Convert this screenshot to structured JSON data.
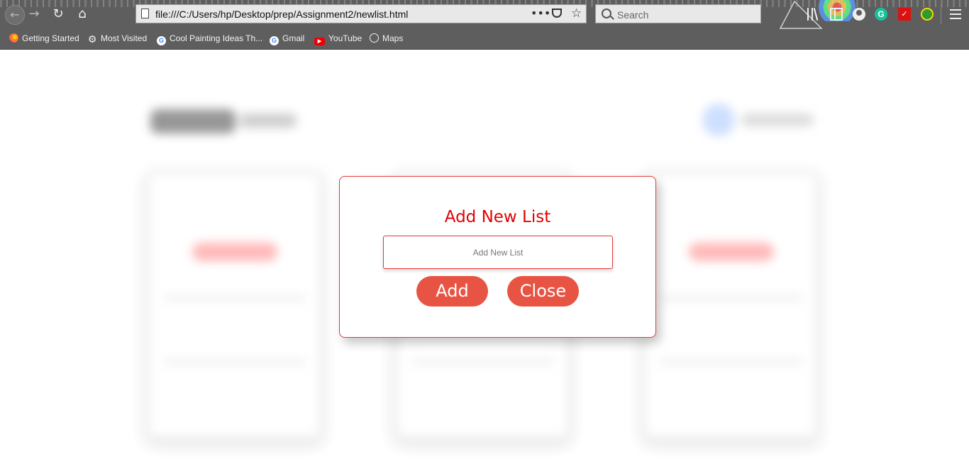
{
  "browser": {
    "url": "file:///C:/Users/hp/Desktop/prep/Assignment2/newlist.html",
    "search_placeholder": "Search",
    "more_glyph": "•••",
    "bookmarks": [
      {
        "label": "Getting Started",
        "icon": "firefox-icon"
      },
      {
        "label": "Most Visited",
        "icon": "gear-icon"
      },
      {
        "label": "Cool Painting Ideas Th...",
        "icon": "google-icon"
      },
      {
        "label": "Gmail",
        "icon": "google-icon"
      },
      {
        "label": "YouTube",
        "icon": "youtube-icon"
      },
      {
        "label": "Maps",
        "icon": "globe-icon"
      }
    ]
  },
  "modal": {
    "title": "Add New List",
    "input_placeholder": "Add New List",
    "input_value": "",
    "add_label": "Add",
    "close_label": "Close"
  },
  "colors": {
    "accent_red": "#e00000",
    "button_red": "#e85444",
    "border_red": "#e53935",
    "chrome_gray": "#5e5e5e"
  }
}
